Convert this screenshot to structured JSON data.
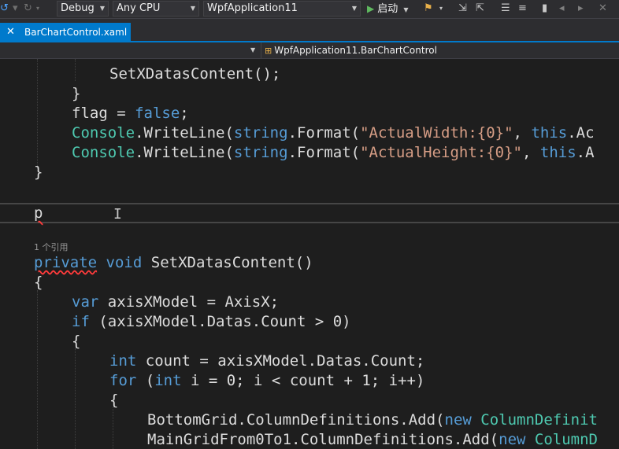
{
  "toolbar": {
    "config": "Debug",
    "platform": "Any CPU",
    "startup_project": "WpfApplication11",
    "start_label": "启动"
  },
  "tab": {
    "close": "✕",
    "file_name": "BarChartControl.xaml"
  },
  "navbar": {
    "class_path": "WpfApplication11.BarChartControl"
  },
  "editor": {
    "references": "1 个引用",
    "code": {
      "l1": "SetXDatasContent();",
      "l2": "}",
      "l3_var": "flag",
      "l3_op": " = ",
      "l3_kw": "false",
      "l3_end": ";",
      "console": "Console",
      "writeline": ".WriteLine(",
      "string_kw": "string",
      "format": ".Format(",
      "str_width": "\"ActualWidth:{0}\"",
      "str_height": "\"ActualHeight:{0}\"",
      "comma": ", ",
      "this_kw": "this",
      "tail_width": ".Ac",
      "tail_height": ".A",
      "close_brace": "}",
      "typed": "p",
      "private_kw": "private",
      "void_kw": "void",
      "method_sig": "SetXDatasContent()",
      "open_brace": "{",
      "var_kw": "var",
      "var_decl": " axisXModel = AxisX;",
      "if_kw": "if",
      "if_cond": " (axisXModel.Datas.Count > 0)",
      "int_kw": "int",
      "count_decl": " count = axisXModel.Datas.Count;",
      "for_kw": "for",
      "for_open": " (",
      "for_rest": " i = 0; i < count + 1; i++)",
      "bottom_grid": "BottomGrid.ColumnDefinitions.Add(",
      "new_kw": "new",
      "col_def_1": "ColumnDefinit",
      "main_grid": "MainGridFrom0To1.ColumnDefinitions.Add(",
      "col_def_2": "ColumnD"
    }
  }
}
